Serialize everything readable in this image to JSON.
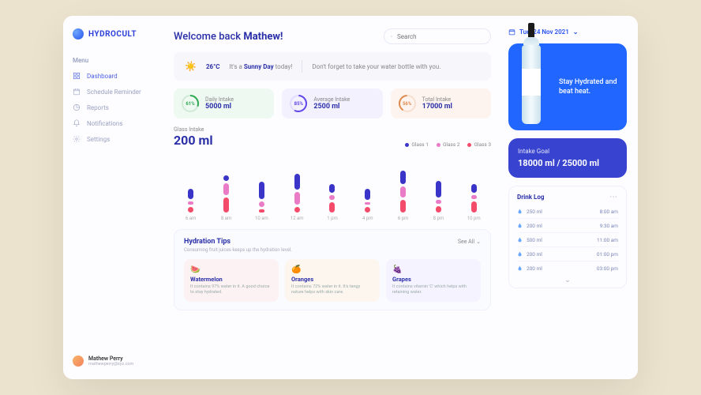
{
  "brand": "HYDROCULT",
  "menu_title": "Menu",
  "sidebar": {
    "items": [
      {
        "label": "Dashboard"
      },
      {
        "label": "Schedule Reminder"
      },
      {
        "label": "Reports"
      },
      {
        "label": "Notifications"
      },
      {
        "label": "Settings"
      }
    ]
  },
  "user": {
    "name": "Mathew Perry",
    "email": "mathewperry@xyz.com"
  },
  "welcome": {
    "prefix": "Welcome back ",
    "name": "Mathew!"
  },
  "search": {
    "placeholder": "Search"
  },
  "banner": {
    "temp": "26°C",
    "highlight_pre": "It's a ",
    "highlight": "Sunny Day",
    "highlight_post": " today!",
    "note": "Don't forget to take your water bottle with you."
  },
  "stats": {
    "daily": {
      "title": "Daily Intake",
      "value": "5000 ml",
      "pct": "61%"
    },
    "average": {
      "title": "Average Intake",
      "value": "2500 ml",
      "pct": "85%"
    },
    "total": {
      "title": "Total Intake",
      "value": "17000 ml",
      "pct": "56%"
    }
  },
  "chart_label": "Glass Intake",
  "chart_value": "200 ml",
  "legend": {
    "g1": "Glass 1",
    "g2": "Glass 2",
    "g3": "Glass 3"
  },
  "chart_data": {
    "type": "bar",
    "title": "Glass Intake",
    "ylabel": "ml",
    "ylim": [
      0,
      200
    ],
    "categories": [
      "6 am",
      "8 am",
      "10 am",
      "12 am",
      "1 pm",
      "4 pm",
      "6 pm",
      "8 pm",
      "10 pm"
    ],
    "series": [
      {
        "name": "Glass 1",
        "color": "#3a35c8",
        "values": [
          120,
          60,
          200,
          180,
          100,
          130,
          160,
          190,
          100
        ]
      },
      {
        "name": "Glass 2",
        "color": "#ea7bc6",
        "values": [
          40,
          140,
          60,
          150,
          50,
          30,
          120,
          50,
          40
        ]
      },
      {
        "name": "Glass 3",
        "color": "#f54b6a",
        "values": [
          60,
          170,
          40,
          60,
          120,
          60,
          150,
          70,
          130
        ]
      }
    ]
  },
  "tips": {
    "title": "Hydration Tips",
    "subtitle": "Consuming fruit juices keeps up the hydration level.",
    "see_all": "See All",
    "cards": [
      {
        "emoji": "🍉",
        "name": "Watermelon",
        "desc": "It contains 97% water in it. A good choice to stay hydrated."
      },
      {
        "emoji": "🍊",
        "name": "Oranges",
        "desc": "It contains 72% water in it. It's tangy nature helps with skin care."
      },
      {
        "emoji": "🍇",
        "name": "Grapes",
        "desc": "It contains vitamin 'C' which helps with retaining water."
      }
    ]
  },
  "date": "Tue, 24 Nov 2021",
  "bottle_text": "Stay Hydrated and beat heat.",
  "goal": {
    "title": "Intake Goal",
    "value": "18000 ml / 25000 ml"
  },
  "drink_log": {
    "title": "Drink Log",
    "items": [
      {
        "amount": "250 ml",
        "time": "8:00 am"
      },
      {
        "amount": "200 ml",
        "time": "9:30 am"
      },
      {
        "amount": "500 ml",
        "time": "11:00 am"
      },
      {
        "amount": "200 ml",
        "time": "01:00 pm"
      },
      {
        "amount": "200 ml",
        "time": "03:00 pm"
      }
    ]
  }
}
